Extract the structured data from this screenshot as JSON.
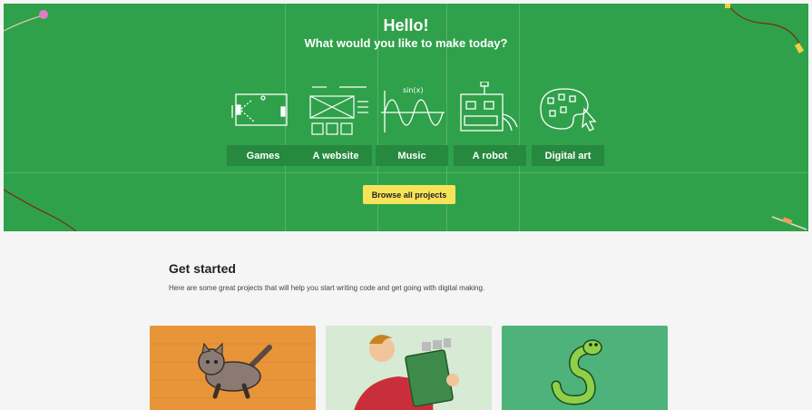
{
  "hero": {
    "title": "Hello!",
    "subtitle": "What would you like to make today?",
    "background": "#2fa14a",
    "categories": [
      {
        "label": "Games",
        "icon": "games-icon"
      },
      {
        "label": "A website",
        "icon": "website-icon"
      },
      {
        "label": "Music",
        "icon": "music-icon"
      },
      {
        "label": "A robot",
        "icon": "robot-icon"
      },
      {
        "label": "Digital art",
        "icon": "palette-icon"
      }
    ],
    "browse_label": "Browse all projects",
    "browse_color": "#f7e35a"
  },
  "get_started": {
    "heading": "Get started",
    "intro": "Here are some great projects that will help you start writing code and get going with digital making.",
    "cards": [
      {
        "name": "scratch-cat-card",
        "color": "#e8953a"
      },
      {
        "name": "raspberry-pi-card",
        "color": "#d6ead4"
      },
      {
        "name": "python-card",
        "color": "#4db37a"
      }
    ]
  }
}
